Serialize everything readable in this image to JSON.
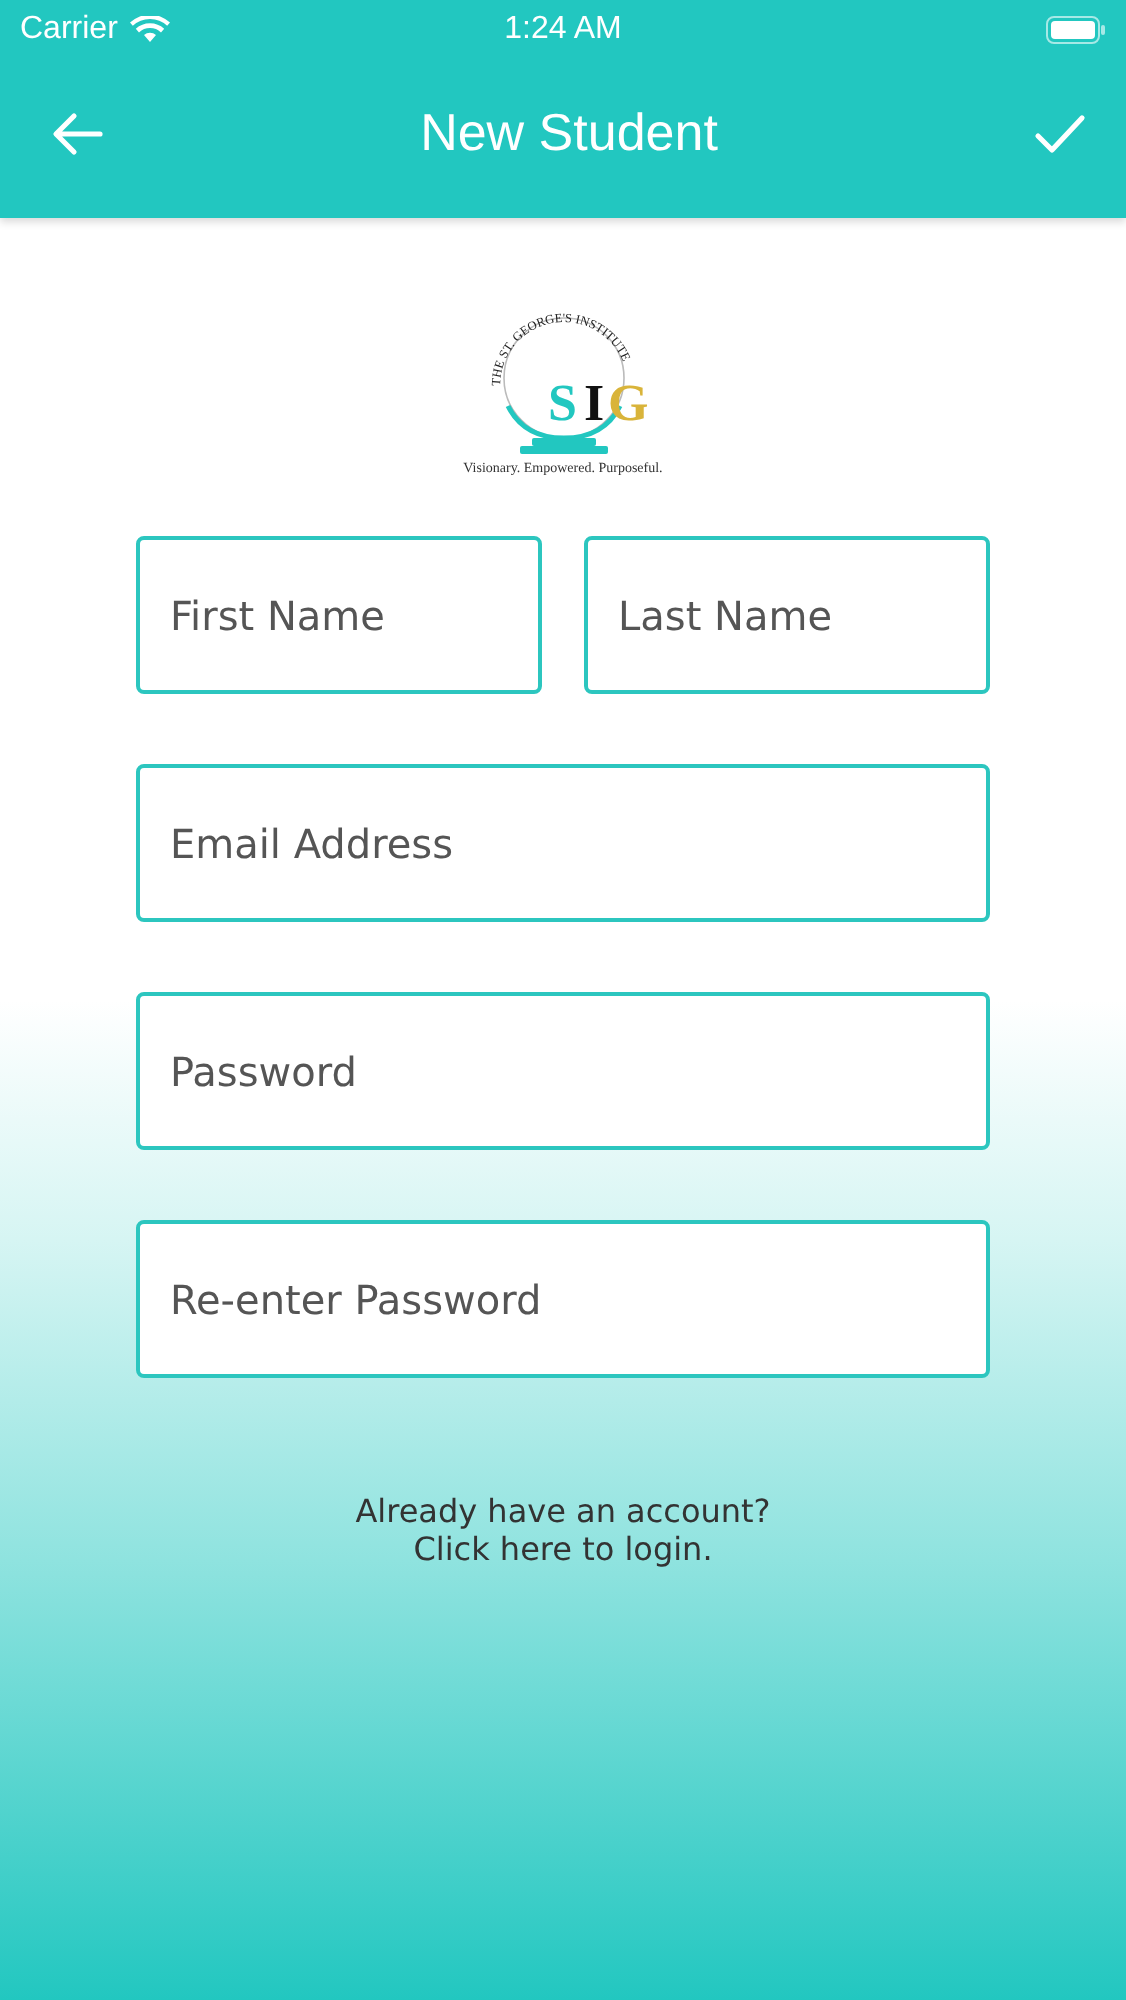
{
  "status_bar": {
    "carrier": "Carrier",
    "time": "1:24 AM"
  },
  "header": {
    "title": "New Student"
  },
  "logo": {
    "name": "THE ST. GEORGE'S INSTITUTE",
    "letters": [
      "S",
      "I",
      "G"
    ],
    "tagline": "Visionary. Empowered. Purposeful."
  },
  "fields": [
    {
      "placeholder": "First Name",
      "kind": "half"
    },
    {
      "placeholder": "Last Name",
      "kind": "half"
    },
    {
      "placeholder": "Email Address",
      "kind": "full"
    },
    {
      "placeholder": "Password",
      "kind": "full"
    },
    {
      "placeholder": "Re-enter Password",
      "kind": "full"
    }
  ],
  "login_prompt": {
    "question": "Already have an account?",
    "link": "Click here to login."
  }
}
